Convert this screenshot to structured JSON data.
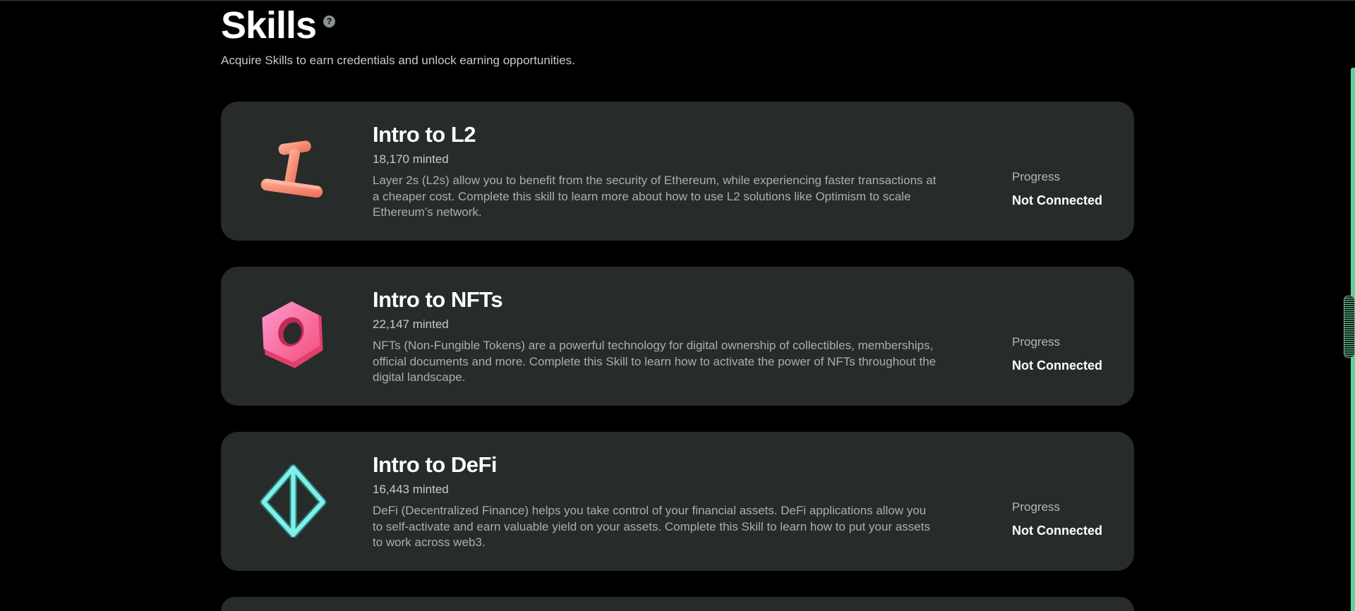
{
  "header": {
    "title": "Skills",
    "help_icon": "question-circle-icon",
    "subtitle": "Acquire Skills to earn credentials and unlock earning opportunities."
  },
  "skills": [
    {
      "title": "Intro to L2",
      "minted": "18,170 minted",
      "description": "Layer 2s (L2s) allow you to benefit from the security of Ethereum, while experiencing faster transactions at a cheaper cost. Complete this skill to learn more about how to use L2 solutions like Optimism to scale Ethereum’s network.",
      "progress_label": "Progress",
      "progress_status": "Not Connected",
      "icon": "l2-token-icon",
      "icon_color": "#f4806a"
    },
    {
      "title": "Intro to NFTs",
      "minted": "22,147 minted",
      "description": "NFTs (Non-Fungible Tokens) are a powerful technology for digital ownership of collectibles, memberships, official documents and more. Complete this Skill to learn how to activate the power of NFTs throughout the digital landscape.",
      "progress_label": "Progress",
      "progress_status": "Not Connected",
      "icon": "hex-nut-icon",
      "icon_color": "#ff6fa8"
    },
    {
      "title": "Intro to DeFi",
      "minted": "16,443 minted",
      "description": "DeFi (Decentralized Finance) helps you take control of your financial assets. DeFi applications allow you to self-activate and earn valuable yield on your assets. Complete this Skill to learn how to put your assets to work across web3.",
      "progress_label": "Progress",
      "progress_status": "Not Connected",
      "icon": "octahedron-icon",
      "icon_color": "#6fe3df"
    }
  ],
  "colors": {
    "background": "#000000",
    "card": "#272c2a",
    "scrollbar_accent": "#5fd39a"
  }
}
